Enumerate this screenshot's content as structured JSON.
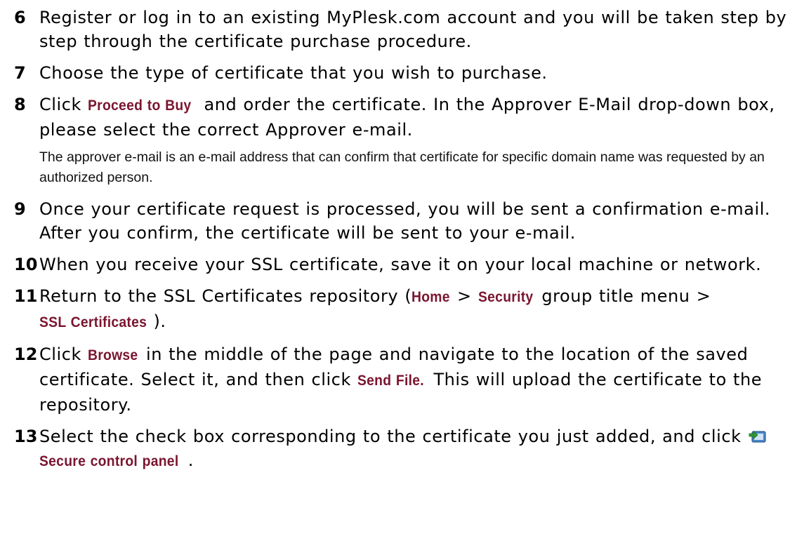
{
  "steps": [
    {
      "number": "6",
      "text": "Register or log in to an existing MyPlesk.com account and you will be taken step by step through the certificate purchase procedure."
    },
    {
      "number": "7",
      "text": "Choose the type of certificate that you wish to purchase."
    },
    {
      "number": "8",
      "pre": "Click ",
      "ui": "Proceed to Buy",
      "post": " and order the certificate. In the Approver E-Mail drop-down box, please select the correct Approver e-mail.",
      "note": "The approver e-mail is an e-mail address that can confirm that certificate for specific domain name was requested by an authorized person."
    },
    {
      "number": "9",
      "text": "Once your certificate request is processed, you will be sent a confirmation e-mail. After you confirm, the certificate will be sent to your e-mail."
    },
    {
      "number": "10",
      "text": "When you receive your SSL certificate, save it on your local machine or network."
    },
    {
      "number": "11",
      "pre": "Return to the SSL Certificates repository (",
      "ui1": "Home",
      "mid1": " > ",
      "ui2": "Security",
      "mid2": " group title menu > ",
      "ui3": "SSL Certificates",
      "post": ")."
    },
    {
      "number": "12",
      "pre": "Click ",
      "ui1": "Browse",
      "mid": " in the middle of the page and navigate to the location of the saved certificate. Select it, and then click ",
      "ui2": "Send File.",
      "post": " This will upload the certificate to the repository."
    },
    {
      "number": "13",
      "pre": "Select the check box corresponding to the certificate you just added, and click ",
      "icon": "secure-panel-icon",
      "ui": "Secure control panel",
      "post": "."
    }
  ],
  "colors": {
    "ui_label": "#7a1530",
    "text": "#000000",
    "icon_arrow": "#2e9a2e",
    "icon_panel": "#4a86c8"
  }
}
